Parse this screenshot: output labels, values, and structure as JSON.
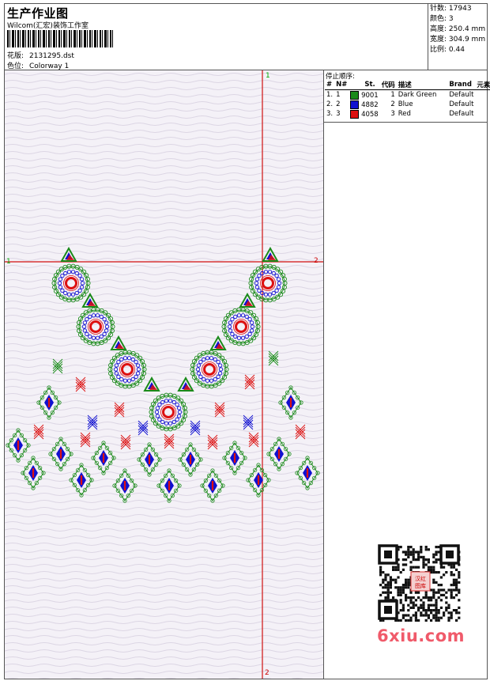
{
  "header": {
    "title": "生产作业图",
    "studio": "Wilcom(汇宏)装饰工作室",
    "pattern_label": "花版:",
    "pattern_value": "2131295.dst",
    "color_label": "色位:",
    "color_value": "Colorway 1"
  },
  "stats": [
    {
      "label": "针数:",
      "value": "17943"
    },
    {
      "label": "颜色:",
      "value": "3"
    },
    {
      "label": "高度:",
      "value": "250.4 mm"
    },
    {
      "label": "宽度:",
      "value": "304.9 mm"
    },
    {
      "label": "比例:",
      "value": "0.44"
    }
  ],
  "stop_sequence": {
    "title": "停止顺序:",
    "columns": [
      "#",
      "N#",
      "St.",
      "代码",
      "描述",
      "Brand",
      "元素"
    ],
    "rows": [
      {
        "idx": "1.",
        "n": "1",
        "color": "#1a8a1a",
        "st": "9001",
        "code": "1",
        "desc": "Dark Green",
        "brand": "Default"
      },
      {
        "idx": "2.",
        "n": "2",
        "color": "#1010d0",
        "st": "4882",
        "code": "2",
        "desc": "Blue",
        "brand": "Default"
      },
      {
        "idx": "3.",
        "n": "3",
        "color": "#dd1010",
        "st": "4058",
        "code": "3",
        "desc": "Red",
        "brand": "Default"
      }
    ]
  },
  "markers": {
    "top": "1",
    "left": "1",
    "right": "2",
    "bottom": "2"
  },
  "watermark": "6xiu.com",
  "qr_stamp": "汉红图库",
  "colors": {
    "green": "#1a8a1a",
    "blue": "#1010d0",
    "red": "#dd1010",
    "crosshair": "#d01010"
  }
}
